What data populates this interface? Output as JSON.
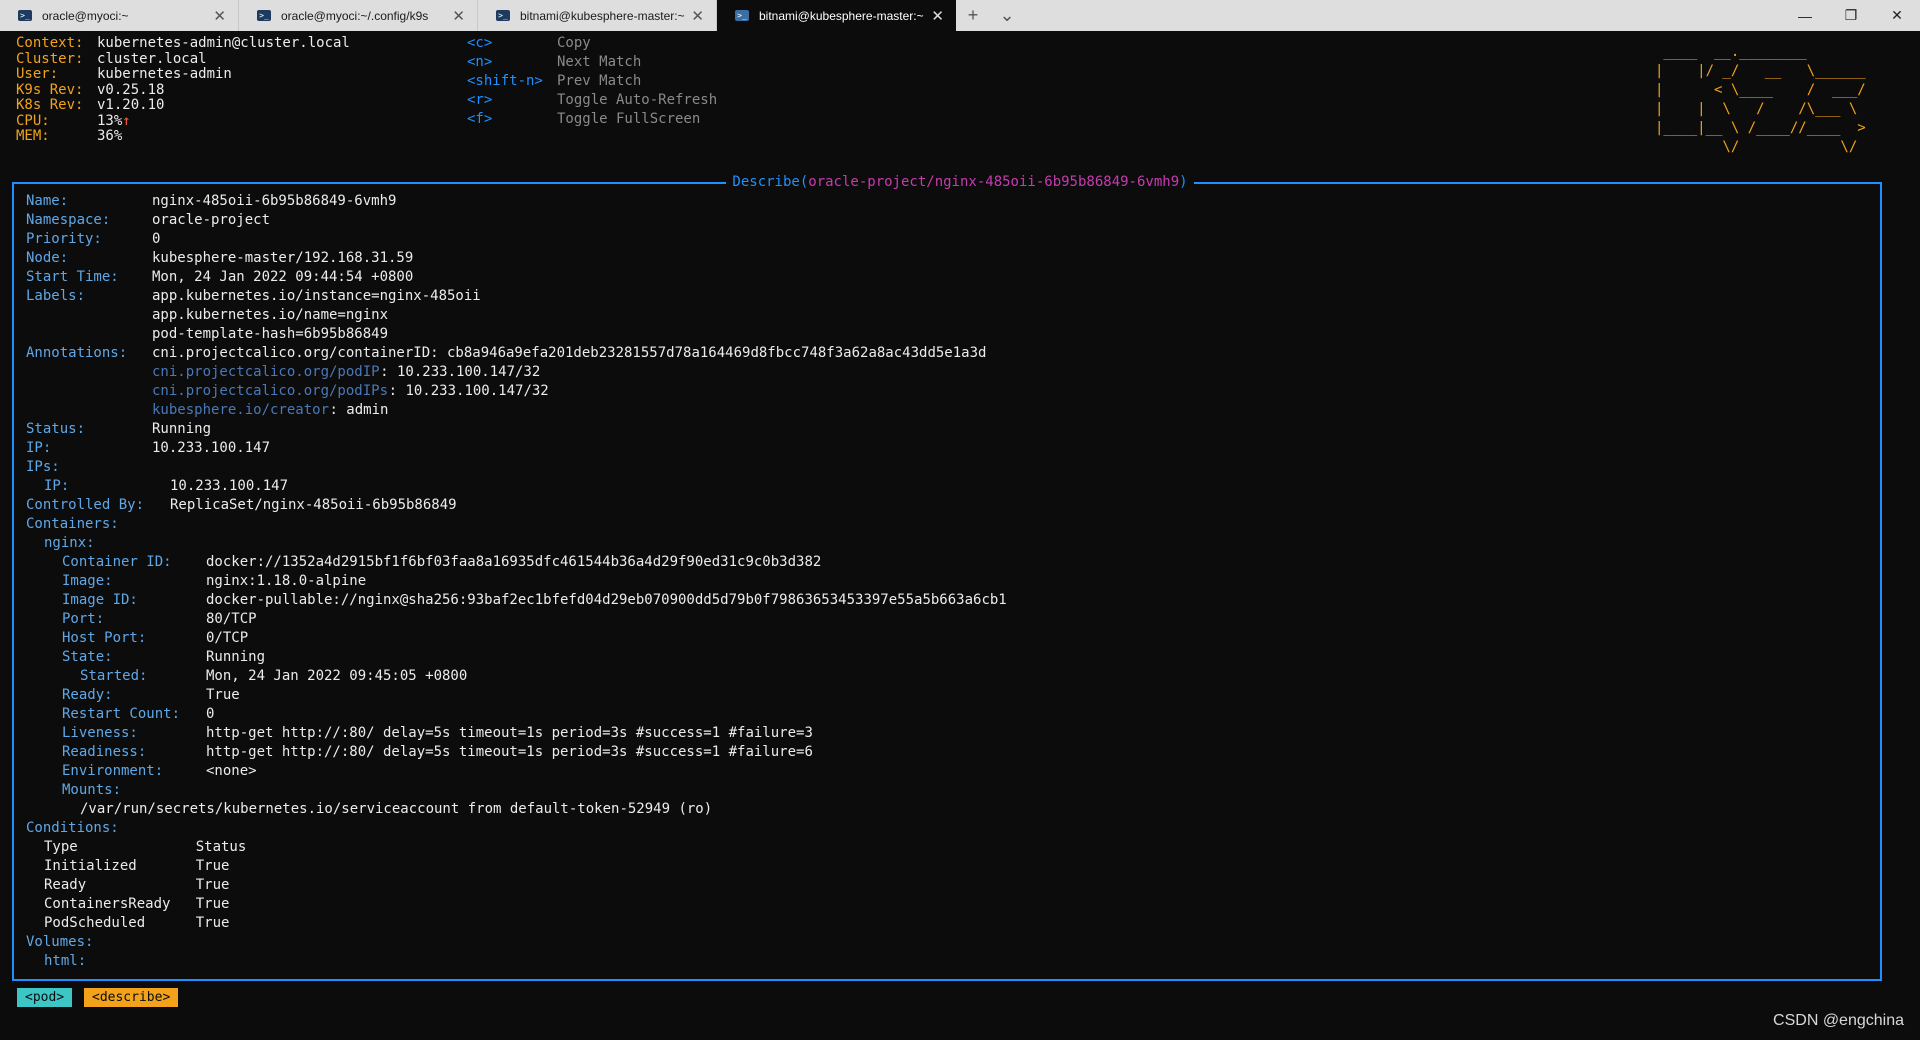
{
  "tabs": [
    {
      "label": "oracle@myoci:~",
      "active": false
    },
    {
      "label": "oracle@myoci:~/.config/k9s",
      "active": false
    },
    {
      "label": "bitnami@kubesphere-master:~",
      "active": false
    },
    {
      "label": "bitnami@kubesphere-master:~",
      "active": true
    }
  ],
  "tab_icon": "terminal-icon",
  "new_tab_glyph": "+",
  "dropdown_glyph": "⌄",
  "window": {
    "minimize": "—",
    "maximize": "❐",
    "close": "✕"
  },
  "header": {
    "info": [
      {
        "key": "Context:",
        "value": "kubernetes-admin@cluster.local"
      },
      {
        "key": "Cluster:",
        "value": "cluster.local"
      },
      {
        "key": "User:",
        "value": "kubernetes-admin"
      },
      {
        "key": "K9s Rev:",
        "value": "v0.25.18"
      },
      {
        "key": "K8s Rev:",
        "value": "v1.20.10"
      },
      {
        "key": "CPU:",
        "value": "13%",
        "trend": "↑"
      },
      {
        "key": "MEM:",
        "value": "36%"
      }
    ],
    "hotkeys": [
      {
        "key": "<c>",
        "action": "Copy"
      },
      {
        "key": "<n>",
        "action": "Next Match"
      },
      {
        "key": "<shift-n>",
        "action": "Prev Match"
      },
      {
        "key": "<r>",
        "action": "Toggle Auto-Refresh"
      },
      {
        "key": "<f>",
        "action": "Toggle FullScreen"
      }
    ],
    "logo_lines": [
      " ____  __.________       ",
      "|    |/ _/   __   \\______",
      "|      < \\____    /  ___/",
      "|    |  \\   /    /\\___ \\ ",
      "|____|__ \\ /____//____  >",
      "        \\/            \\/ "
    ]
  },
  "describe": {
    "title_prefix": "Describe(",
    "title_resource": "oracle-project/nginx-485oii-6b95b86849-6vmh9",
    "title_suffix": ")",
    "lines": [
      {
        "indent": 0,
        "label": "Name:",
        "col": 140,
        "value": "nginx-485oii-6b95b86849-6vmh9"
      },
      {
        "indent": 0,
        "label": "Namespace:",
        "col": 140,
        "value": "oracle-project"
      },
      {
        "indent": 0,
        "label": "Priority:",
        "col": 140,
        "value": "0"
      },
      {
        "indent": 0,
        "label": "Node:",
        "col": 140,
        "value": "kubesphere-master/192.168.31.59"
      },
      {
        "indent": 0,
        "label": "Start Time:",
        "col": 140,
        "value": "Mon, 24 Jan 2022 09:44:54 +0800"
      },
      {
        "indent": 0,
        "label": "Labels:",
        "col": 140,
        "value": "app.kubernetes.io/instance=nginx-485oii"
      },
      {
        "indent": 0,
        "label": "",
        "col": 140,
        "value": "app.kubernetes.io/name=nginx"
      },
      {
        "indent": 0,
        "label": "",
        "col": 140,
        "value": "pod-template-hash=6b95b86849"
      },
      {
        "indent": 0,
        "label": "Annotations:",
        "col": 140,
        "value": "cni.projectcalico.org/containerID: cb8a946a9efa201deb23281557d78a164469d8fbcc748f3a62a8ac43dd5e1a3d"
      },
      {
        "indent": 0,
        "label": "",
        "col": 140,
        "akey": "cni.projectcalico.org/podIP",
        "value": ": 10.233.100.147/32"
      },
      {
        "indent": 0,
        "label": "",
        "col": 140,
        "akey": "cni.projectcalico.org/podIPs",
        "value": ": 10.233.100.147/32"
      },
      {
        "indent": 0,
        "label": "",
        "col": 140,
        "akey": "kubesphere.io/creator",
        "value": ": admin"
      },
      {
        "indent": 0,
        "label": "Status:",
        "col": 140,
        "value": "Running"
      },
      {
        "indent": 0,
        "label": "IP:",
        "col": 140,
        "value": "10.233.100.147"
      },
      {
        "indent": 0,
        "label": "IPs:",
        "col": 140,
        "value": ""
      },
      {
        "indent": 1,
        "label": "IP:",
        "col": 158,
        "value": "10.233.100.147"
      },
      {
        "indent": 0,
        "label": "Controlled By:",
        "col": 158,
        "value": "ReplicaSet/nginx-485oii-6b95b86849"
      },
      {
        "indent": 0,
        "label": "Containers:",
        "col": 140,
        "value": ""
      },
      {
        "indent": 1,
        "label": "nginx:",
        "col": 140,
        "value": ""
      },
      {
        "indent": 2,
        "label": "Container ID:",
        "col": 194,
        "value": "docker://1352a4d2915bf1f6bf03faa8a16935dfc461544b36a4d29f90ed31c9c0b3d382"
      },
      {
        "indent": 2,
        "label": "Image:",
        "col": 194,
        "value": "nginx:1.18.0-alpine"
      },
      {
        "indent": 2,
        "label": "Image ID:",
        "col": 194,
        "value": "docker-pullable://nginx@sha256:93baf2ec1bfefd04d29eb070900dd5d79b0f79863653453397e55a5b663a6cb1"
      },
      {
        "indent": 2,
        "label": "Port:",
        "col": 194,
        "value": "80/TCP"
      },
      {
        "indent": 2,
        "label": "Host Port:",
        "col": 194,
        "value": "0/TCP"
      },
      {
        "indent": 2,
        "label": "State:",
        "col": 194,
        "value": "Running"
      },
      {
        "indent": 3,
        "label": "Started:",
        "col": 194,
        "value": "Mon, 24 Jan 2022 09:45:05 +0800"
      },
      {
        "indent": 2,
        "label": "Ready:",
        "col": 194,
        "value": "True"
      },
      {
        "indent": 2,
        "label": "Restart Count:",
        "col": 194,
        "value": "0"
      },
      {
        "indent": 2,
        "label": "Liveness:",
        "col": 194,
        "value": "http-get http://:80/ delay=5s timeout=1s period=3s #success=1 #failure=3"
      },
      {
        "indent": 2,
        "label": "Readiness:",
        "col": 194,
        "value": "http-get http://:80/ delay=5s timeout=1s period=3s #success=1 #failure=6"
      },
      {
        "indent": 2,
        "label": "Environment:",
        "col": 194,
        "value": "<none>"
      },
      {
        "indent": 2,
        "label": "Mounts:",
        "col": 194,
        "value": ""
      },
      {
        "indent": 3,
        "label": "",
        "col": 68,
        "value": "/var/run/secrets/kubernetes.io/serviceaccount from default-token-52949 (ro)"
      },
      {
        "indent": 0,
        "label": "Conditions:",
        "col": 140,
        "value": ""
      },
      {
        "indent": 1,
        "label": "",
        "col": 36,
        "value": "Type              Status"
      },
      {
        "indent": 1,
        "label": "",
        "col": 36,
        "value": "Initialized       True"
      },
      {
        "indent": 1,
        "label": "",
        "col": 36,
        "value": "Ready             True"
      },
      {
        "indent": 1,
        "label": "",
        "col": 36,
        "value": "ContainersReady   True"
      },
      {
        "indent": 1,
        "label": "",
        "col": 36,
        "value": "PodScheduled      True"
      },
      {
        "indent": 0,
        "label": "Volumes:",
        "col": 140,
        "value": ""
      },
      {
        "indent": 1,
        "label": "html:",
        "col": 140,
        "value": ""
      }
    ]
  },
  "breadcrumbs": [
    {
      "label": "<pod>",
      "color": "#3cc6c6"
    },
    {
      "label": "<describe>",
      "color": "#f2a31b"
    }
  ],
  "watermark": "CSDN @engchina",
  "colors": {
    "accent_blue": "#1e90ff",
    "orange": "#f2a31b",
    "label_blue": "#5fa8e8",
    "magenta": "#c73bb0"
  }
}
